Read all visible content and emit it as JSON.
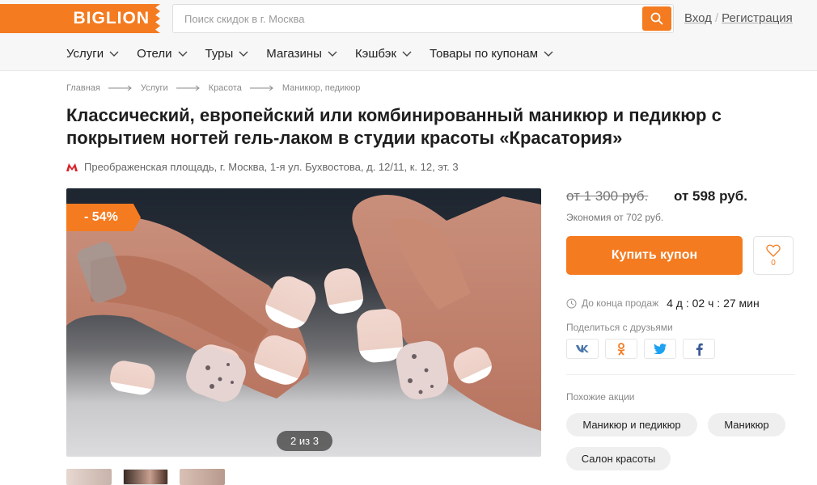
{
  "header": {
    "logo": "BIGLION",
    "search_placeholder": "Поиск скидок в г. Москва",
    "login": "Вход",
    "register": "Регистрация",
    "accent": "#f47b20"
  },
  "nav": [
    {
      "label": "Услуги"
    },
    {
      "label": "Отели"
    },
    {
      "label": "Туры"
    },
    {
      "label": "Магазины"
    },
    {
      "label": "Кэшбэк"
    },
    {
      "label": "Товары по купонам"
    }
  ],
  "breadcrumb": [
    "Главная",
    "Услуги",
    "Красота",
    "Маникюр, педикюр"
  ],
  "title": "Классический, европейский или комбинированный маникюр и педикюр с покрытием ногтей гель-лаком в студии красоты «Красатория»",
  "address": "Преображенская площадь, г. Москва, 1-я ул. Бухвостова, д. 12/11, к. 12, эт. 3",
  "gallery": {
    "discount": "- 54%",
    "counter": "2 из 3"
  },
  "offer": {
    "old_price": "от 1 300 руб.",
    "new_price": "от 598 руб.",
    "saving": "Экономия от 702 руб.",
    "buy_label": "Купить купон",
    "favorites_count": "0",
    "deadline_label": "До конца продаж",
    "deadline_time": "4 д : 02 ч : 27 мин",
    "share_label": "Поделиться с друзьями",
    "shares": [
      "vk",
      "ok",
      "twitter",
      "facebook"
    ],
    "similar_label": "Похожие акции",
    "similar_tags": [
      "Маникюр и педикюр",
      "Маникюр",
      "Салон красоты"
    ]
  }
}
